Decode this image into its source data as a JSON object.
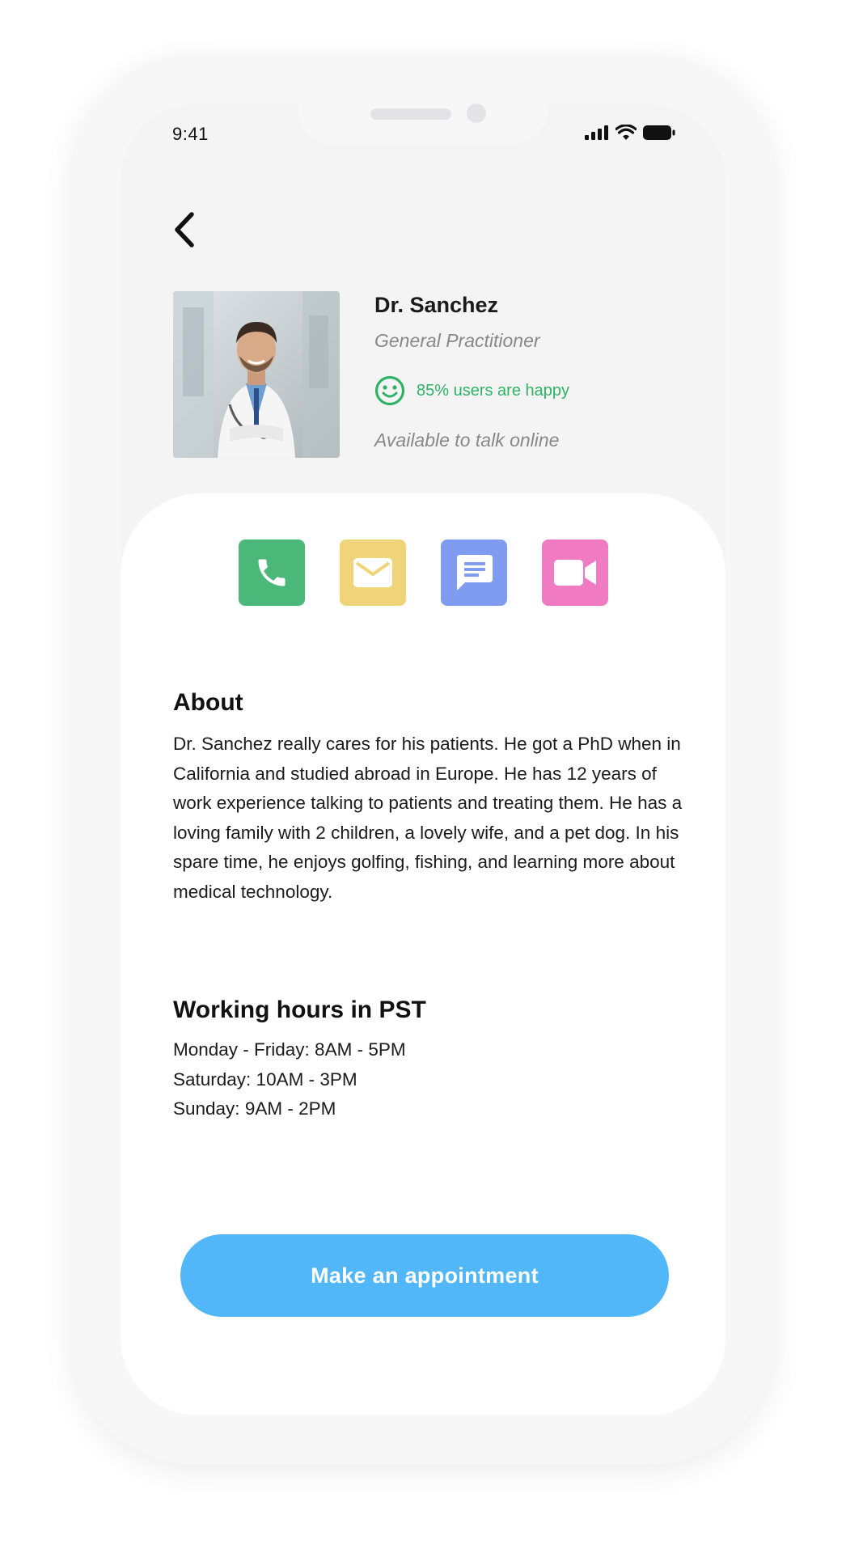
{
  "status_bar": {
    "time": "9:41"
  },
  "navigation": {
    "back_icon": "chevron-left-icon"
  },
  "doctor": {
    "name": "Dr. Sanchez",
    "specialty": "General Practitioner",
    "happy_icon": "smiley-icon",
    "satisfaction": "85% users are happy",
    "availability": "Available to talk online"
  },
  "contact_actions": [
    {
      "icon": "phone-icon",
      "color": "#4bb778"
    },
    {
      "icon": "mail-icon",
      "color": "#f0d47a"
    },
    {
      "icon": "message-icon",
      "color": "#7f9cf0"
    },
    {
      "icon": "video-icon",
      "color": "#f07bc3"
    }
  ],
  "about": {
    "title": "About",
    "text": "Dr. Sanchez really cares for his patients. He got a PhD when in California and studied abroad in Europe. He has 12 years of work experience talking to patients and treating them. He has a loving family with 2 children, a lovely wife, and a pet dog. In his spare time, he enjoys golfing, fishing, and learning more about medical technology."
  },
  "hours": {
    "title": "Working hours in PST",
    "items": [
      "Monday - Friday: 8AM - 5PM",
      "Saturday: 10AM - 3PM",
      "Sunday: 9AM - 2PM"
    ]
  },
  "cta": {
    "label": "Make an appointment",
    "color": "#52b7f8"
  }
}
